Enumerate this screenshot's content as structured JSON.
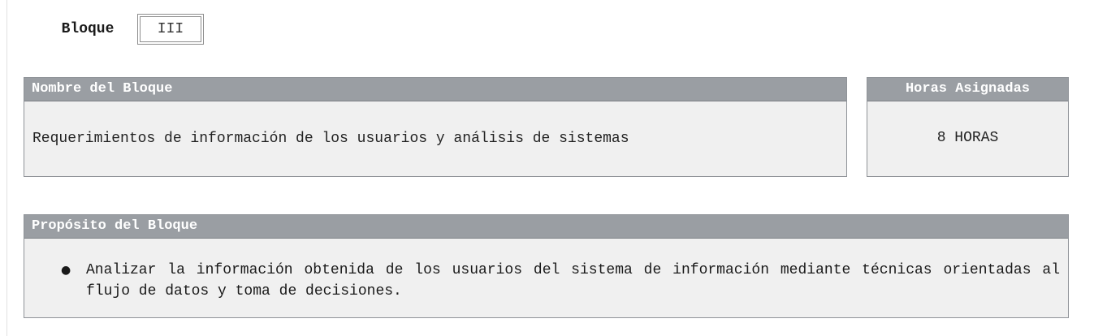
{
  "bloque": {
    "label": "Bloque",
    "value": "III"
  },
  "nombre": {
    "header": "Nombre del Bloque",
    "text": "Requerimientos de información de los usuarios y análisis de sistemas"
  },
  "horas": {
    "header": "Horas Asignadas",
    "text": "8 HORAS"
  },
  "proposito": {
    "header": "Propósito del Bloque",
    "items": [
      "Analizar la información obtenida de los usuarios del sistema de información mediante técnicas orientadas al flujo de datos y toma de decisiones."
    ]
  },
  "colors": {
    "header_bg": "#9a9ea3",
    "box_bg": "#f0f0f0",
    "border": "#8f9398"
  }
}
